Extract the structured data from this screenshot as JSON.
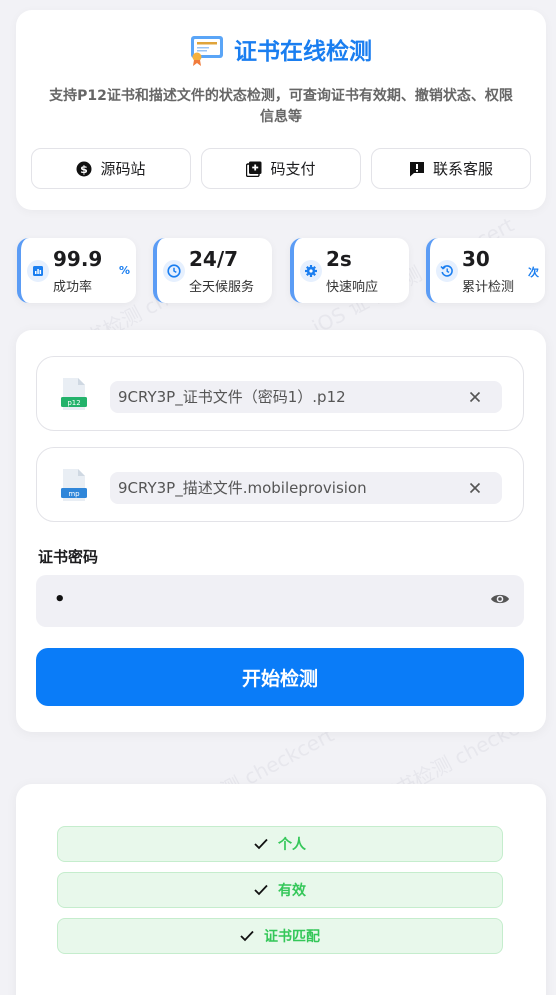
{
  "header": {
    "title": "证书在线检测",
    "subtitle": "支持P12证书和描述文件的状态检测，可查询证书有效期、撤销状态、权限信息等",
    "icon": "certificate-icon",
    "buttons": [
      {
        "label": "源码站",
        "icon": "dollar-icon"
      },
      {
        "label": "码支付",
        "icon": "plus-square-icon"
      },
      {
        "label": "联系客服",
        "icon": "chat-icon"
      }
    ]
  },
  "stats": [
    {
      "value": "99.9",
      "label": "成功率",
      "unit": "%",
      "icon": "chart-icon"
    },
    {
      "value": "24/7",
      "label": "全天候服务",
      "unit": "",
      "icon": "clock-icon"
    },
    {
      "value": "2s",
      "label": "快速响应",
      "unit": "",
      "icon": "gear-icon"
    },
    {
      "value": "30",
      "label": "累计检测",
      "unit": "次",
      "icon": "history-icon"
    }
  ],
  "form": {
    "files": [
      {
        "name": "9CRY3P_证书文件（密码1）.p12",
        "badge": "p12",
        "icon": "p12-file-icon"
      },
      {
        "name": "9CRY3P_描述文件.mobileprovision",
        "badge": "mp",
        "icon": "mobileprovision-file-icon"
      }
    ],
    "password_label": "证书密码",
    "password_value": "•",
    "submit_label": "开始检测"
  },
  "results": [
    {
      "label": "个人",
      "icon": "check-icon"
    },
    {
      "label": "有效",
      "icon": "check-icon"
    },
    {
      "label": "证书匹配",
      "icon": "check-icon"
    }
  ],
  "watermark_text": "iOS 证书检测 checkcert",
  "colors": {
    "accent": "#0a7cf8",
    "title": "#1a7ef0",
    "success": "#34c759",
    "success_bg": "#e8f8eb",
    "stat_border": "#5b9cf5",
    "background": "#f2f2f6"
  }
}
